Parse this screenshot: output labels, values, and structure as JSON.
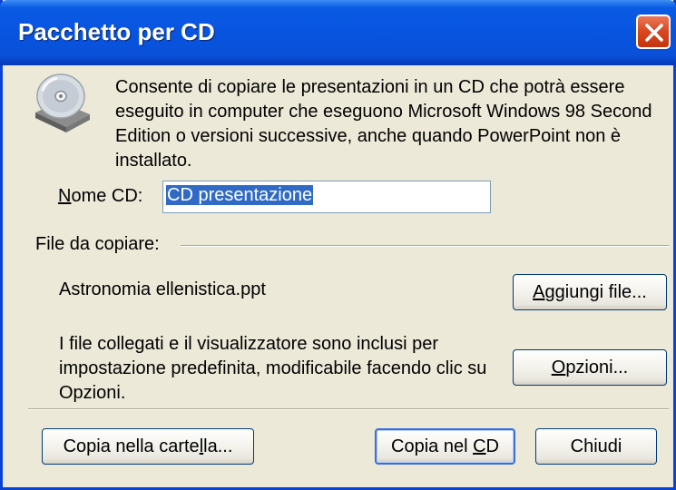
{
  "window": {
    "title": "Pacchetto per CD"
  },
  "description": "Consente di copiare le presentazioni in un CD che potrà essere eseguito in computer che eseguono Microsoft Windows 98 Second Edition o versioni successive, anche quando PowerPoint non è installato.",
  "cd_name": {
    "label_accel": "N",
    "label_rest": "ome CD:",
    "value": "CD presentazione"
  },
  "files": {
    "group_label": "File da copiare:",
    "items": [
      "Astronomia ellenistica.ppt"
    ]
  },
  "add_files_button": {
    "accel": "A",
    "rest": "ggiungi file..."
  },
  "info_text": "I file collegati e il visualizzatore sono inclusi per impostazione predefinita, modificabile facendo clic su Opzioni.",
  "options_button": {
    "accel": "O",
    "rest": "pzioni..."
  },
  "copy_folder_button": {
    "before": "Copia nella carte",
    "accel": "l",
    "after": "la..."
  },
  "copy_cd_button": {
    "before": "Copia nel ",
    "accel": "C",
    "after": "D"
  },
  "close_button": {
    "label": "Chiudi"
  },
  "icons": {
    "cd_drive": "cd-drive-icon",
    "close": "close-icon"
  }
}
